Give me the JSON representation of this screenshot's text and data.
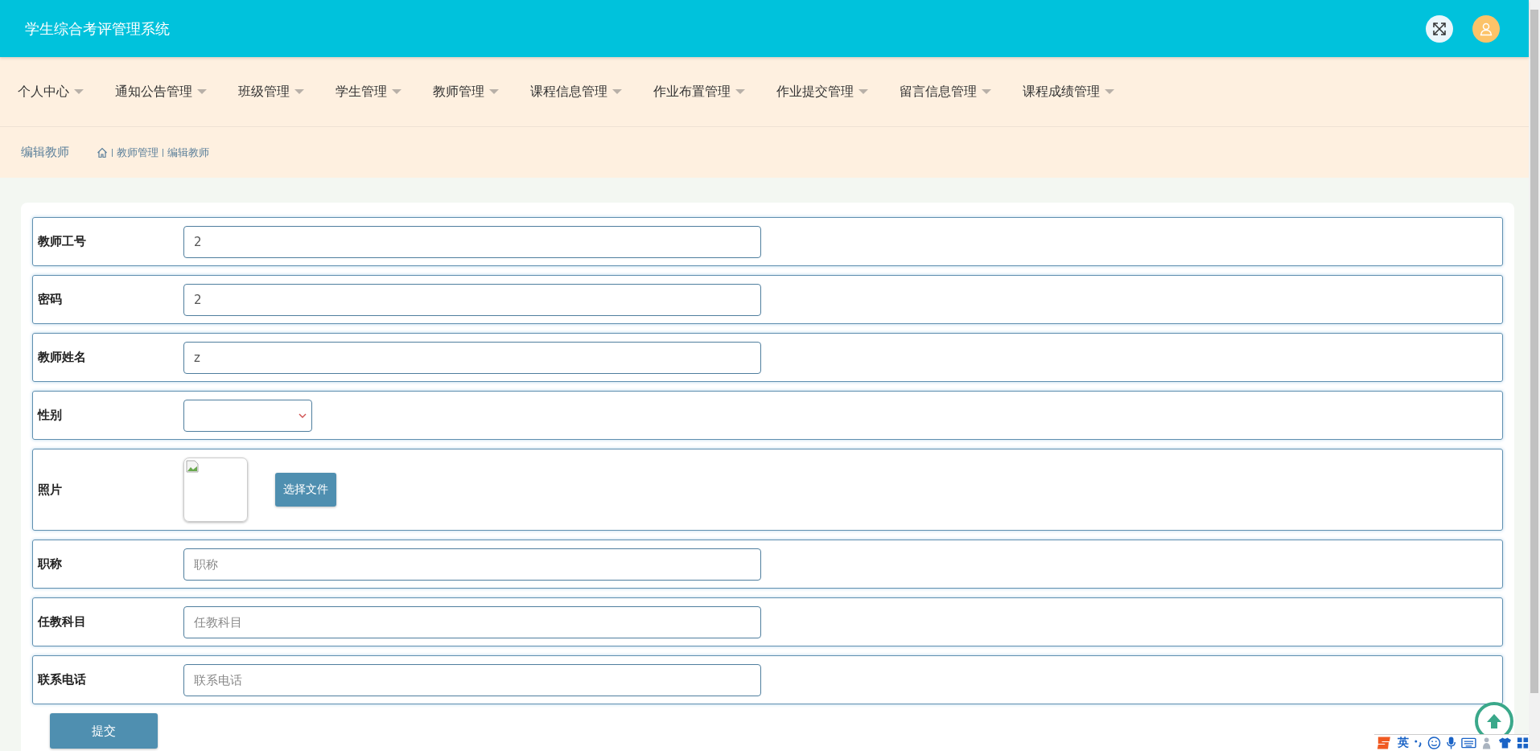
{
  "header": {
    "title": "学生综合考评管理系统"
  },
  "nav": [
    {
      "label": "个人中心"
    },
    {
      "label": "通知公告管理"
    },
    {
      "label": "班级管理"
    },
    {
      "label": "学生管理"
    },
    {
      "label": "教师管理"
    },
    {
      "label": "课程信息管理"
    },
    {
      "label": "作业布置管理"
    },
    {
      "label": "作业提交管理"
    },
    {
      "label": "留言信息管理"
    },
    {
      "label": "课程成绩管理"
    }
  ],
  "breadcrumb": {
    "page_title": "编辑教师",
    "trail": [
      "教师管理",
      "编辑教师"
    ]
  },
  "form": {
    "fields": [
      {
        "kind": "text",
        "label": "教师工号",
        "value": "2"
      },
      {
        "kind": "text",
        "label": "密码",
        "value": "2"
      },
      {
        "kind": "text",
        "label": "教师姓名",
        "value": "z"
      },
      {
        "kind": "select",
        "label": "性别"
      },
      {
        "kind": "image",
        "label": "照片",
        "button": "选择文件"
      },
      {
        "kind": "text",
        "label": "职称",
        "placeholder": "职称"
      },
      {
        "kind": "text",
        "label": "任教科目",
        "placeholder": "任教科目"
      },
      {
        "kind": "text",
        "label": "联系电话",
        "placeholder": "联系电话"
      }
    ],
    "submit": "提交"
  },
  "ime_toolbar": {
    "mode": "英"
  }
}
